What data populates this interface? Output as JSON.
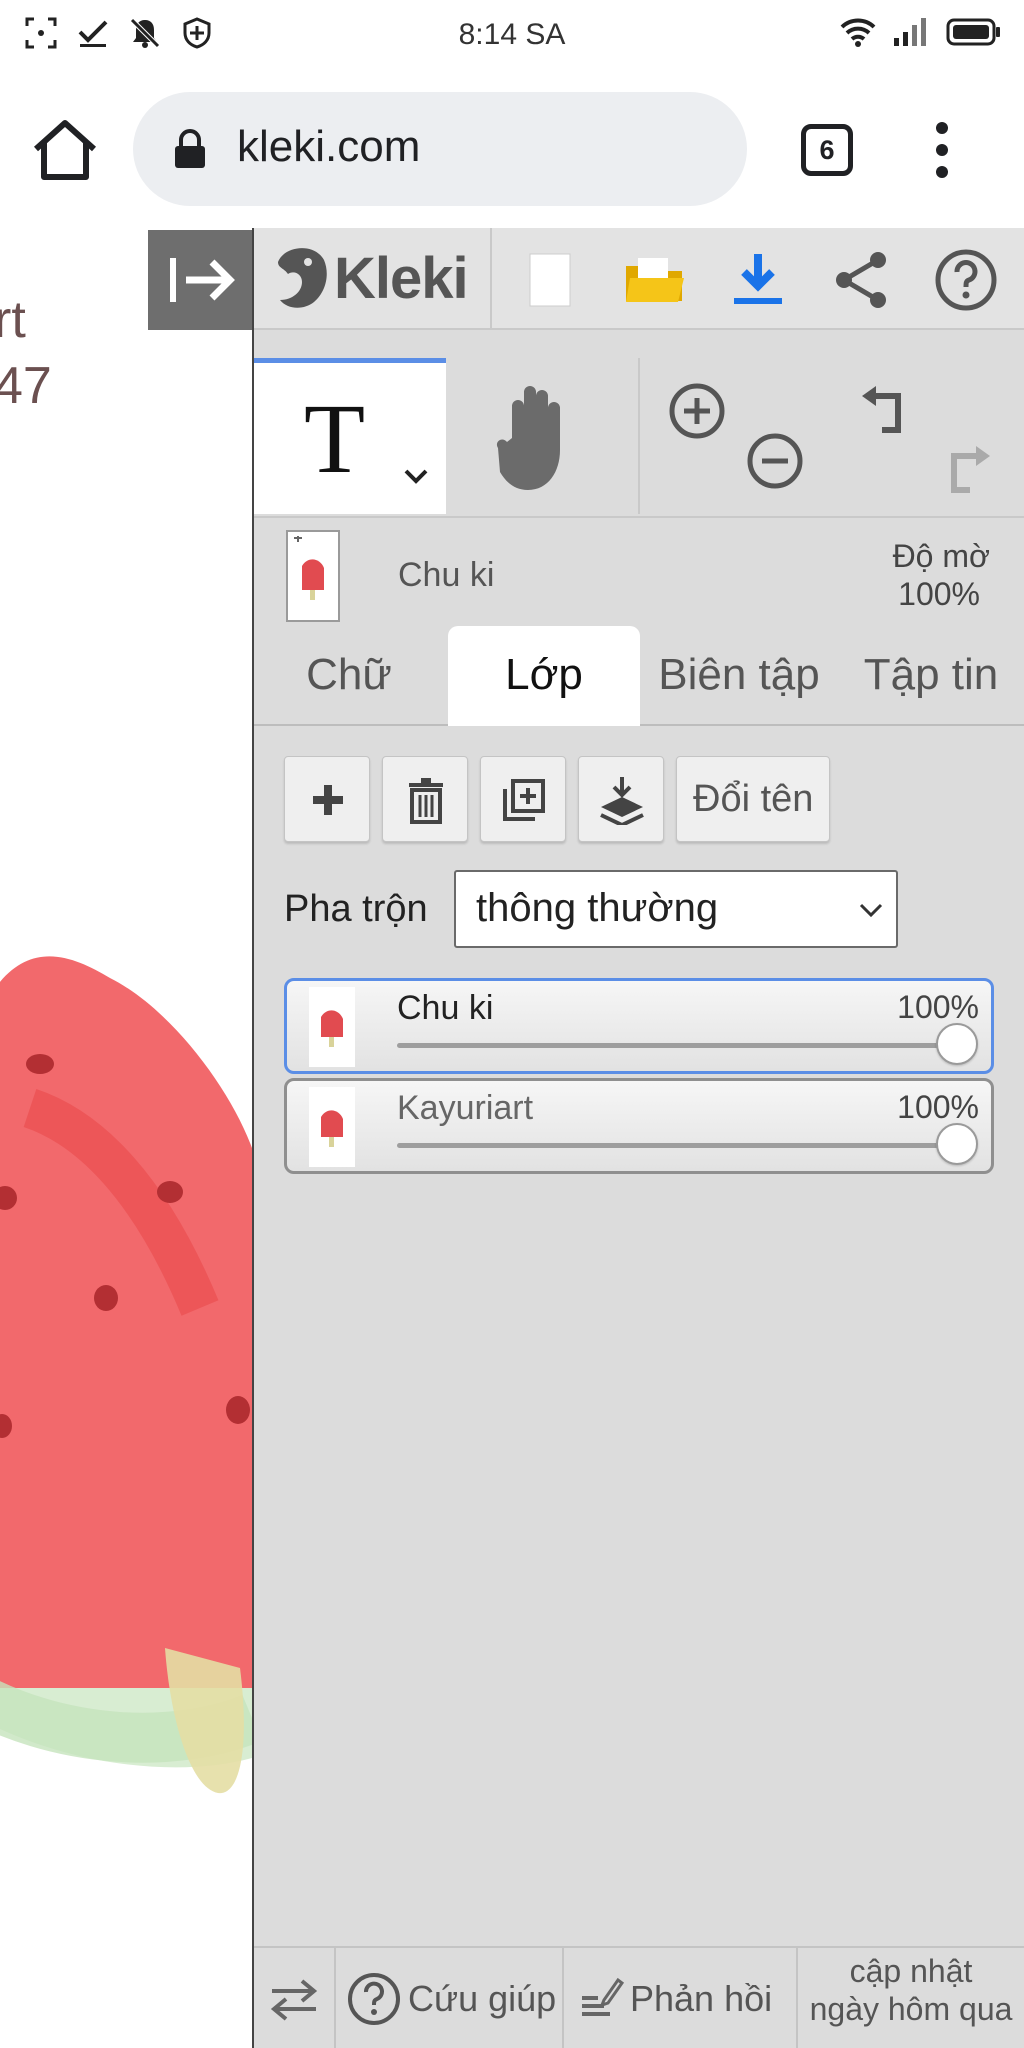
{
  "status_bar": {
    "time": "8:14 SA"
  },
  "browser": {
    "url": "kleki.com",
    "tab_count": "6"
  },
  "canvas": {
    "partial_text_line1": "rt",
    "partial_text_line2": "47"
  },
  "app": {
    "name": "Kleki",
    "accent_color": "#5b8ee6",
    "download_icon_color": "#1a73e8",
    "folder_icon_color": "#f5c518"
  },
  "tools": {
    "active_tool": "T"
  },
  "active_layer": {
    "name": "Chu ki",
    "opacity_label": "Độ mờ",
    "opacity_value": "100%"
  },
  "tabs": [
    {
      "label": "Chữ"
    },
    {
      "label": "Lớp"
    },
    {
      "label": "Biên tập"
    },
    {
      "label": "Tập tin"
    }
  ],
  "layer_actions": {
    "rename_label": "Đổi tên"
  },
  "blend": {
    "label": "Pha trộn",
    "value": "thông thường"
  },
  "layers": [
    {
      "name": "Chu ki",
      "opacity": "100%",
      "opacity_fraction": 1.0,
      "selected": true
    },
    {
      "name": "Kayuriart",
      "opacity": "100%",
      "opacity_fraction": 1.0,
      "selected": false
    }
  ],
  "footer": {
    "help_label": "Cứu giúp",
    "feedback_label": "Phản hồi",
    "update_line1": "cập nhật",
    "update_line2": "ngày hôm qua"
  }
}
